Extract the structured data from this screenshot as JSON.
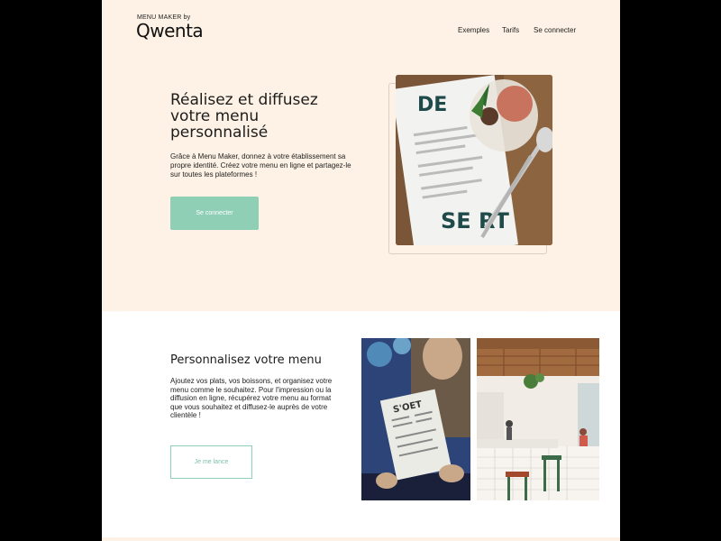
{
  "header": {
    "logo_small": "MENU MAKER by",
    "logo_brand": "Qwenta",
    "nav": [
      "Exemples",
      "Tarifs",
      "Se connecter"
    ]
  },
  "hero": {
    "title": "Réalisez et diffusez votre menu personnalisé",
    "text": "Grâce à Menu Maker, donnez à votre établissement sa propre identité. Créez votre menu en ligne et partagez-le sur toutes les plateformes !",
    "button": "Se connecter",
    "menu_word_top": "DE",
    "menu_word_bottom": "SE RT"
  },
  "section2": {
    "title": "Personnalisez votre menu",
    "text": "Ajoutez vos plats, vos boissons, et organisez votre menu comme le souhaitez. Pour l'impression ou la diffusion en ligne, récupérez votre menu au format que vous souhaitez et diffusez-le auprès de votre clientèle !",
    "button": "Je me lance",
    "menu_card_title": "S'OET"
  },
  "colors": {
    "hero_bg": "#fdf2e5",
    "accent": "#8fcfb6"
  }
}
